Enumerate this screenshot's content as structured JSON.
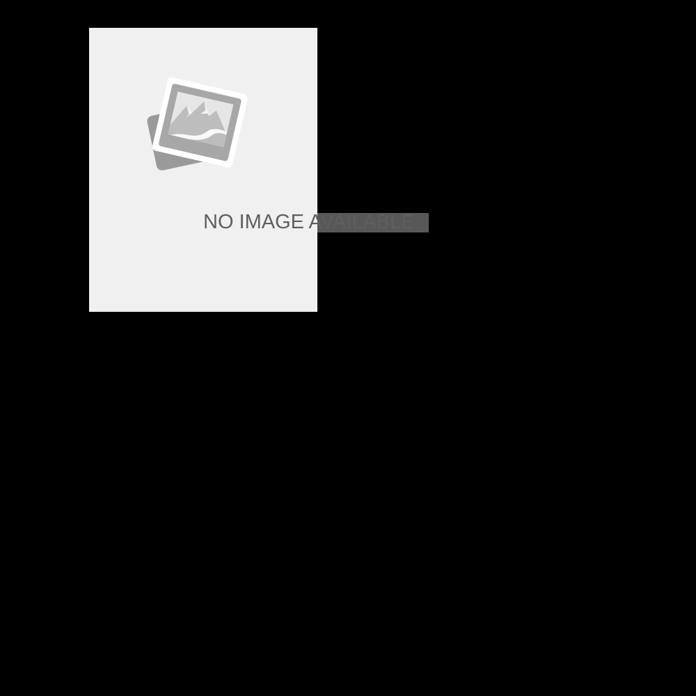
{
  "placeholder": {
    "caption": "NO IMAGE AVAILABLE",
    "icon": "photo-placeholder-icon",
    "colors": {
      "page_background": "#000000",
      "card_background": "#f0f0f0",
      "icon_gray": "#9a9a9a",
      "icon_light": "#e6e6e6",
      "text_gray": "#5f5f5f"
    }
  }
}
